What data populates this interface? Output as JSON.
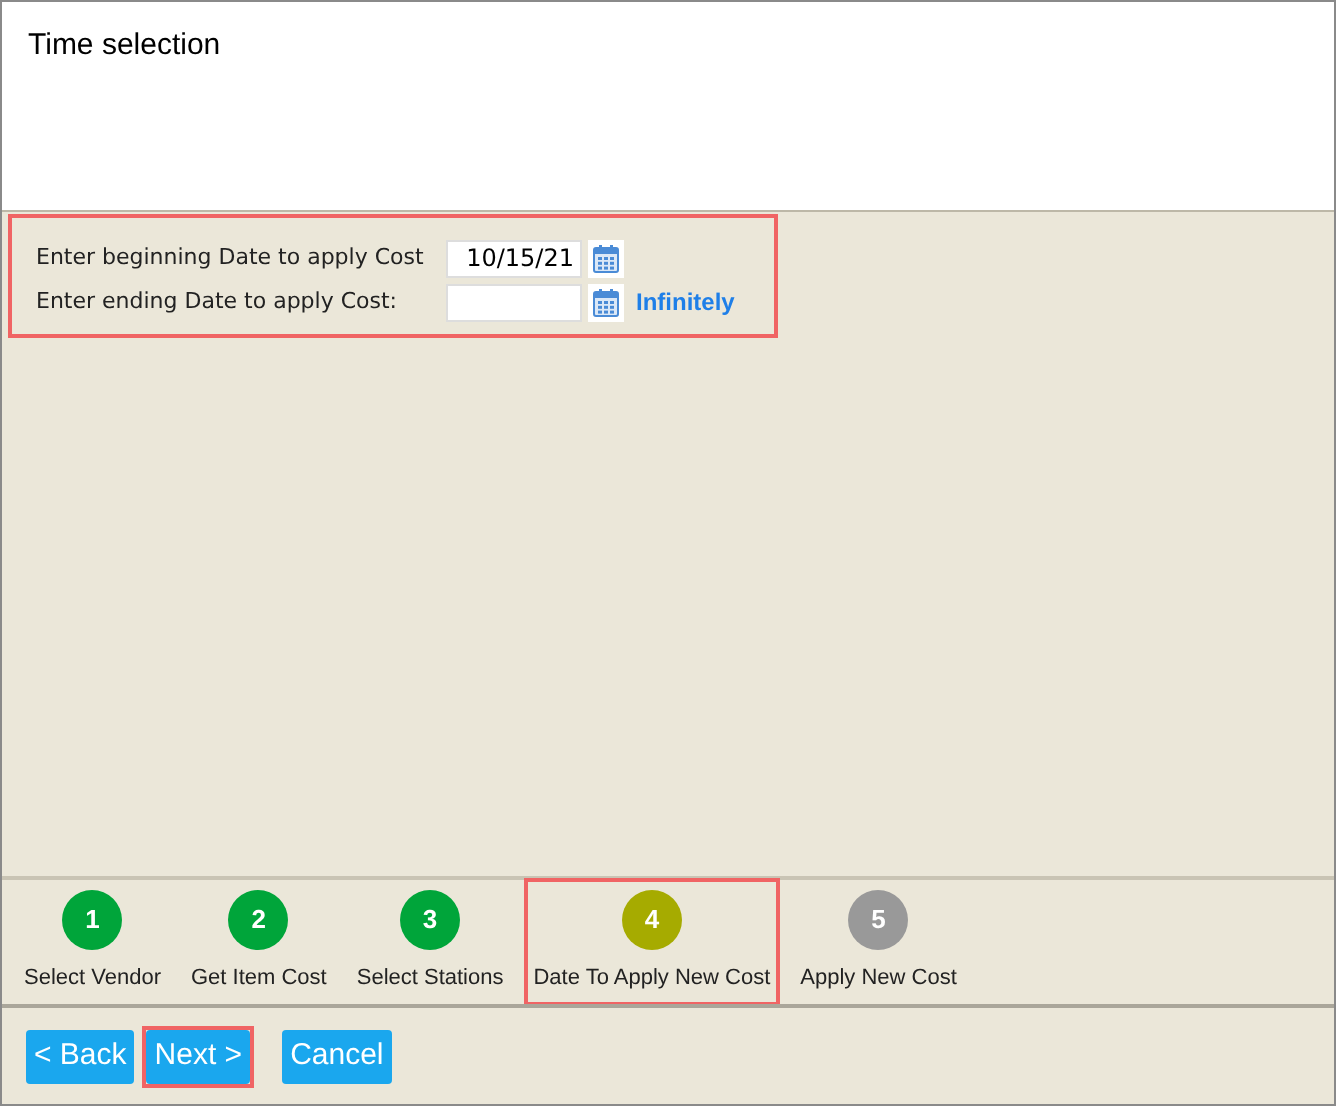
{
  "title": "Time selection",
  "date_form": {
    "highlighted": true,
    "fields": [
      {
        "label": "Enter beginning Date to apply Cost",
        "value": "10/15/21"
      },
      {
        "label": "Enter ending Date to apply Cost:",
        "link": "Infinitely"
      }
    ]
  },
  "steps": [
    {
      "number": "1",
      "label": "Select Vendor",
      "color": "#00a53a",
      "highlighted": false
    },
    {
      "number": "2",
      "label": "Get Item Cost",
      "color": "#00a53a",
      "highlighted": false
    },
    {
      "number": "3",
      "label": "Select Stations",
      "color": "#00a53a",
      "highlighted": false
    },
    {
      "number": "4",
      "label": "Date To Apply New Cost",
      "color": "#a6ab00",
      "highlighted": true
    },
    {
      "number": "5",
      "label": "Apply New Cost",
      "color": "#999999",
      "highlighted": false
    }
  ],
  "buttons": [
    {
      "label": "< Back",
      "highlighted": false
    },
    {
      "label": "Next >",
      "highlighted": true
    },
    {
      "label": "Cancel",
      "highlighted": false
    }
  ]
}
